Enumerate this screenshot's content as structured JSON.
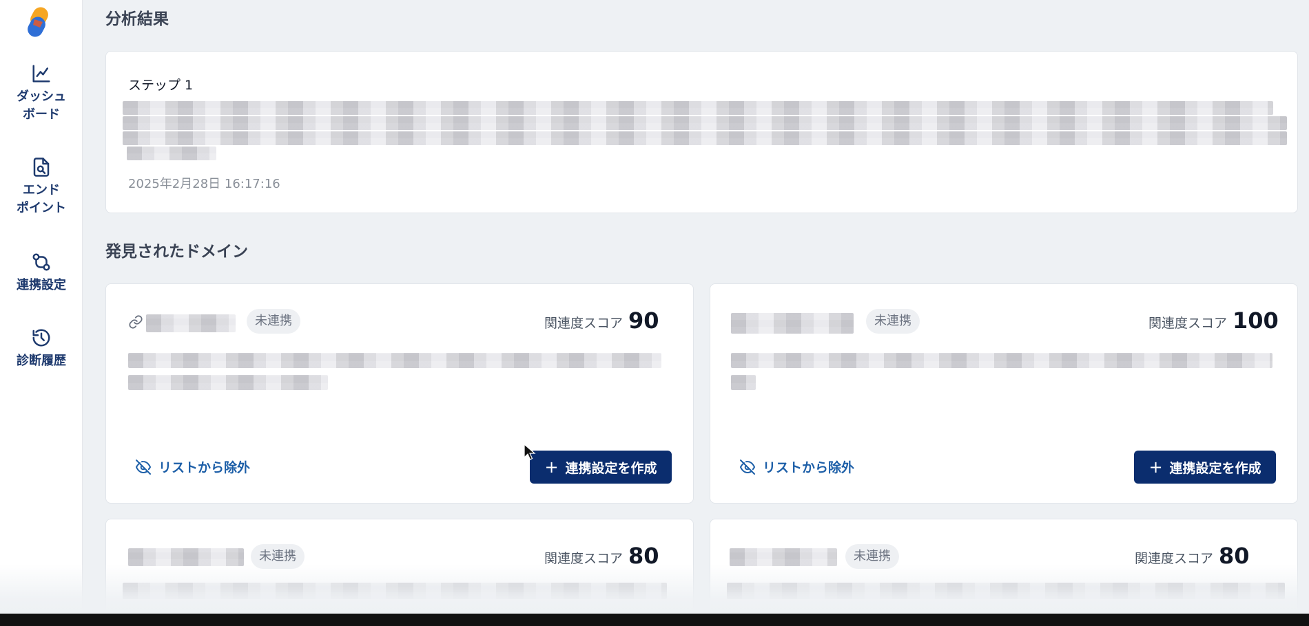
{
  "sidebar": {
    "items": [
      {
        "label": "ダッシュ\nボード",
        "icon": "chart-line-icon"
      },
      {
        "label": "エンド\nポイント",
        "icon": "file-search-icon"
      },
      {
        "label": "連携設定",
        "icon": "git-compare-icon"
      },
      {
        "label": "診断履歴",
        "icon": "history-icon"
      }
    ]
  },
  "analysis": {
    "title": "分析結果",
    "step_label": "ステップ 1",
    "timestamp": "2025年2月28日 16:17:16"
  },
  "domains": {
    "title": "発見されたドメイン",
    "cards": [
      {
        "status": "未連携",
        "score_label": "関連度スコア",
        "score": "90",
        "exclude_label": "リストから除外",
        "create_label": "連携設定を作成"
      },
      {
        "status": "未連携",
        "score_label": "関連度スコア",
        "score": "100",
        "exclude_label": "リストから除外",
        "create_label": "連携設定を作成"
      },
      {
        "status": "未連携",
        "score_label": "関連度スコア",
        "score": "80"
      },
      {
        "status": "未連携",
        "score_label": "関連度スコア",
        "score": "80"
      }
    ]
  },
  "colors": {
    "primary_button": "#0b2d6e",
    "link_blue": "#1d5fa8",
    "nav_text": "#1e3a6e",
    "page_bg": "#eef1f4"
  }
}
